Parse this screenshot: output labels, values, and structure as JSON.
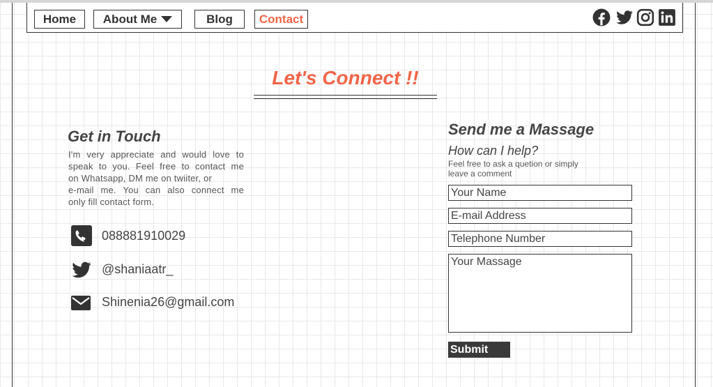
{
  "nav": {
    "home": "Home",
    "about": "About Me",
    "blog": "Blog",
    "contact": "Contact"
  },
  "social_icons": [
    "facebook-icon",
    "twitter-icon",
    "instagram-icon",
    "linkedin-icon"
  ],
  "colors": {
    "accent": "#f06548",
    "text": "#444444",
    "button": "#3a3a3a"
  },
  "hero": {
    "title": "Let's Connect !!"
  },
  "get_in_touch": {
    "heading": "Get in Touch",
    "lines": [
      "I'm very appreciate and would love to",
      "speak to you. Feel free to contact me",
      "on Whatsapp, DM me on twiiter, or",
      "e-mail me. You can also connect me",
      "only fill contact form."
    ],
    "phone": "088881910029",
    "twitter": "@shaniaatr_",
    "email": "Shinenia26@gmail.com"
  },
  "form": {
    "heading": "Send me a Massage",
    "subheading": "How can I help?",
    "note_lines": [
      "Feel free to ask a quetion or simply",
      "leave a comment"
    ],
    "name_placeholder": "Your Name",
    "email_placeholder": "E-mail Address",
    "phone_placeholder": "Telephone Number",
    "message_placeholder": "Your Massage",
    "submit": "Submit"
  }
}
